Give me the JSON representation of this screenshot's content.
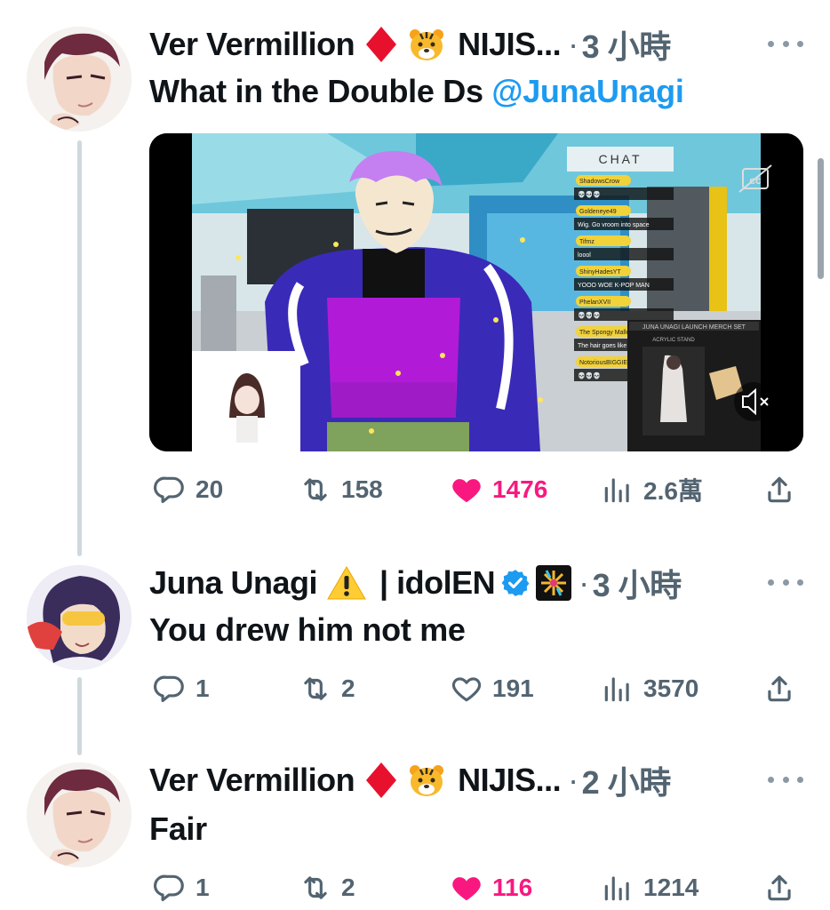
{
  "tweets": [
    {
      "author": "Ver Vermillion",
      "suffix": "NIJIS...",
      "badges": [
        "red-diamond-emoji",
        "tiger-emoji"
      ],
      "time": "3 小時",
      "text": "What in the Double Ds ",
      "mention": "@JunaUnagi",
      "replies": "20",
      "retweets": "158",
      "likes": "1476",
      "liked": true,
      "views": "2.6萬"
    },
    {
      "author": "Juna Unagi",
      "suffix": "| idolEN",
      "badges": [
        "warning-emoji",
        "verified-badge",
        "idol-logo"
      ],
      "time": "3 小時",
      "text": "You drew him not me",
      "replies": "1",
      "retweets": "2",
      "likes": "191",
      "liked": false,
      "views": "3570"
    },
    {
      "author": "Ver Vermillion",
      "suffix": "NIJIS...",
      "badges": [
        "red-diamond-emoji",
        "tiger-emoji"
      ],
      "time": "2 小時",
      "text": "Fair",
      "replies": "1",
      "retweets": "2",
      "likes": "116",
      "liked": true,
      "views": "1214"
    }
  ],
  "media": {
    "chat_header": "CHAT",
    "merch_title": "JUNA UNAGI LAUNCH MERCH SET",
    "merch_subtitle": "ACRYLIC STAND",
    "cc_icon": "cc-icon",
    "mute_icon": "mute-icon",
    "chat_lines": [
      {
        "user": "ShadowsCrow",
        "msg": "💀💀💀"
      },
      {
        "user": "Goldeneye49",
        "msg": "Wig. Go vroom into space"
      },
      {
        "user": "Tifmz",
        "msg": "loool"
      },
      {
        "user": "ShinyHadesYT",
        "msg": "YOOO WOE K-POP MAN"
      },
      {
        "user": "PhelanXVII",
        "msg": "💀💀💀"
      },
      {
        "user": "The Spongy Mallet",
        "msg": "The hair goes like"
      },
      {
        "user": "NotoriousBIGGIE",
        "msg": "💀💀💀"
      }
    ]
  },
  "colors": {
    "link": "#1d9bf0",
    "like": "#f91880",
    "muted": "#536471",
    "thread_line": "#cfd9de"
  }
}
